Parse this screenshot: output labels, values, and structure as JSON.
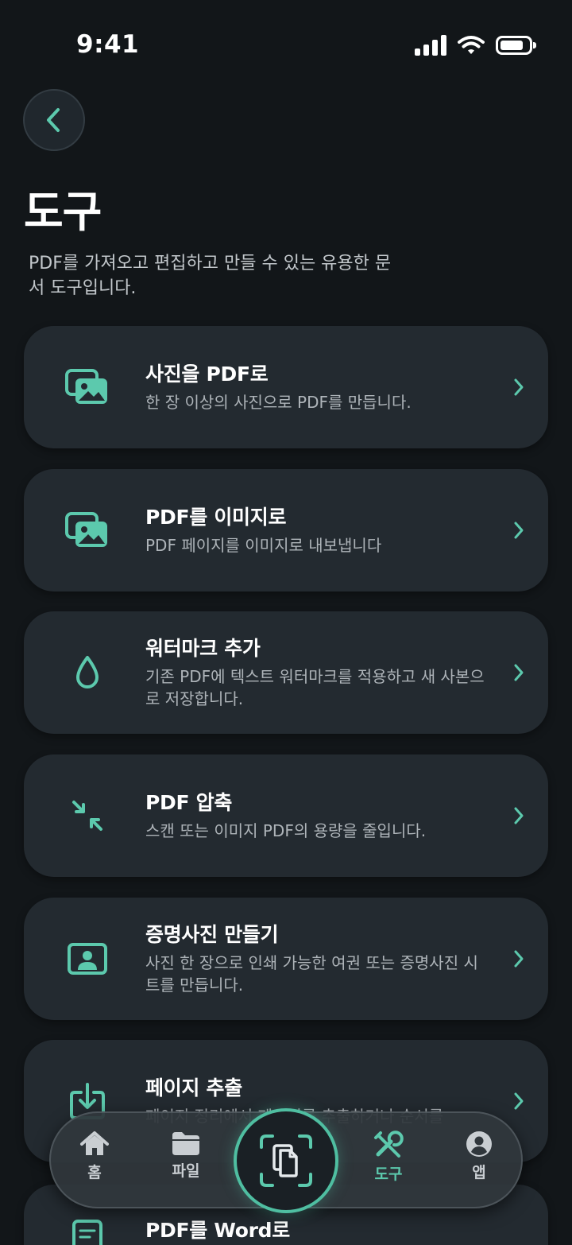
{
  "status_bar": {
    "time": "9:41"
  },
  "header": {
    "title": "도구",
    "description": "PDF를 가져오고 편집하고 만들 수 있는 유용한 문서 도구입니다."
  },
  "tools": [
    {
      "title": "사진을 PDF로",
      "desc": "한 장 이상의 사진으로 PDF를 만듭니다.",
      "icon": "photos-icon"
    },
    {
      "title": "PDF를 이미지로",
      "desc": "PDF 페이지를 이미지로 내보냅니다",
      "icon": "images-icon"
    },
    {
      "title": "워터마크 추가",
      "desc": "기존 PDF에 텍스트 워터마크를 적용하고 새 사본으로 저장합니다.",
      "icon": "drop-icon"
    },
    {
      "title": "PDF 압축",
      "desc": "스캔 또는 이미지 PDF의 용량을 줄입니다.",
      "icon": "compress-icon"
    },
    {
      "title": "증명사진 만들기",
      "desc": "사진 한 장으로 인쇄 가능한 여권 또는 증명사진 시트를 만듭니다.",
      "icon": "id-photo-icon"
    },
    {
      "title": "페이지 추출",
      "desc": "페이지 정리에서 페이지를 추출하거나 순서를",
      "icon": "extract-icon"
    },
    {
      "title": "PDF를 Word로",
      "desc": "",
      "icon": "word-icon"
    }
  ],
  "bottom_nav": [
    {
      "label": "홈",
      "icon": "home-icon"
    },
    {
      "label": "파일",
      "icon": "folder-icon"
    },
    {
      "label": "도구",
      "icon": "tools-icon",
      "active": true
    },
    {
      "label": "앱",
      "icon": "profile-icon"
    }
  ],
  "colors": {
    "accent": "#5cc9ad",
    "card": "#232a30",
    "background": "#121619"
  }
}
